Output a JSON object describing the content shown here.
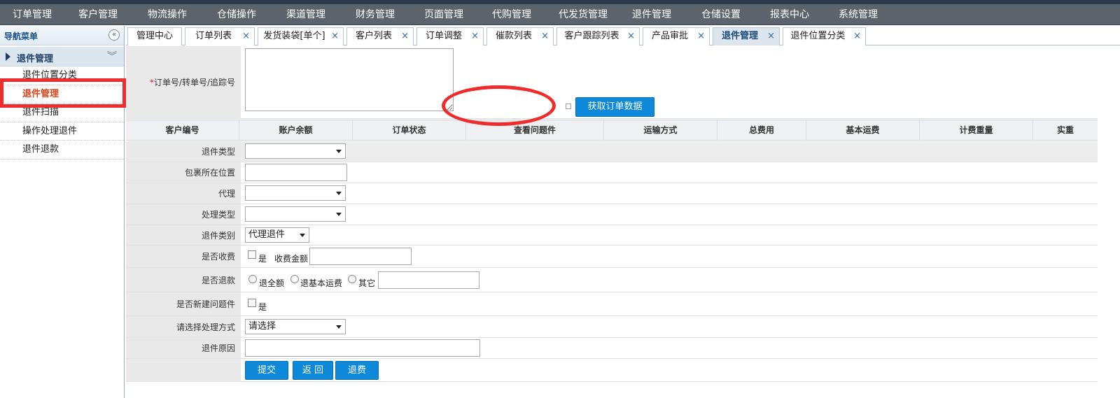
{
  "top_nav": [
    "订单管理",
    "客户管理",
    "物流操作",
    "仓储操作",
    "渠道管理",
    "财务管理",
    "页面管理",
    "代购管理",
    "代发货管理",
    "退件管理",
    "仓储设置",
    "报表中心",
    "系统管理"
  ],
  "sidebar": {
    "title": "导航菜单",
    "collapse_icon": "«",
    "group_label": "退件管理",
    "group_chevron": "︾",
    "items": [
      "退件位置分类",
      "退件管理",
      "退件扫描",
      "操作处理退件",
      "退件退款"
    ]
  },
  "tabs": [
    {
      "label": "管理中心",
      "close": ""
    },
    {
      "label": "订单列表",
      "close": "×"
    },
    {
      "label": "发货装袋[单个]",
      "close": "×"
    },
    {
      "label": "客户列表",
      "close": "×"
    },
    {
      "label": "订单调整",
      "close": "×"
    },
    {
      "label": "催款列表",
      "close": "×"
    },
    {
      "label": "客户跟踪列表",
      "close": "×"
    },
    {
      "label": "产品审批",
      "close": "×"
    },
    {
      "label": "退件管理",
      "close": "×"
    },
    {
      "label": "退件位置分类",
      "close": "×"
    }
  ],
  "form": {
    "order_label_req": "*",
    "order_label": "订单号/转单号/追踪号",
    "order_value": "",
    "fetch_button": "获取订单数据",
    "table_headers": [
      "客户编号",
      "账户余额",
      "订单状态",
      "查看问题件",
      "运输方式",
      "总费用",
      "基本运费",
      "计费重量",
      "实重"
    ],
    "return_type_label": "退件类型",
    "return_type_value": "",
    "location_label": "包裹所在位置",
    "location_value": "",
    "agent_label": "代理",
    "agent_value": "",
    "process_type_label": "处理类型",
    "process_type_value": "",
    "category_label": "退件类别",
    "category_value": "代理退件",
    "charge_label": "是否收费",
    "charge_yes": "是",
    "charge_amount_label": "收费金额",
    "charge_amount_value": "",
    "refund_label": "是否退款",
    "refund_full": "退全额",
    "refund_basic": "退基本运费",
    "refund_other": "其它",
    "refund_other_value": "",
    "new_issue_label": "是否新建问题件",
    "new_issue_yes": "是",
    "method_label": "请选择处理方式",
    "method_value": "请选择",
    "reason_label": "退件原因",
    "reason_value": "",
    "submit_button": "提交",
    "back_button": "返 回",
    "fee_button": "退费"
  },
  "colors": {
    "accent": "#0e88d9",
    "nav": "#5b646d",
    "highlight": "#ee2c2c",
    "active_menu": "#e0421a"
  }
}
